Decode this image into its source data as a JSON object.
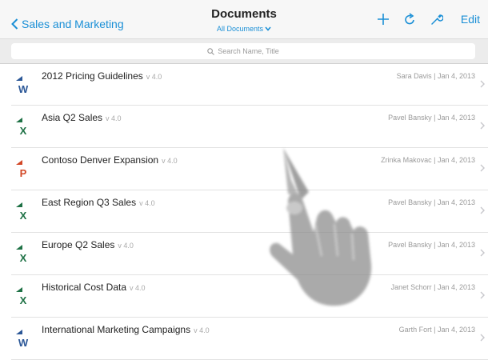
{
  "header": {
    "back_label": "Sales and Marketing",
    "title": "Documents",
    "subtitle": "All Documents",
    "edit_label": "Edit"
  },
  "search": {
    "placeholder": "Search Name, Title"
  },
  "colors": {
    "accent": "#1a8fd6",
    "word": "#2b5797",
    "excel": "#1e7145",
    "powerpoint": "#d24726"
  },
  "documents": [
    {
      "name": "2012 Pricing Guidelines",
      "version": "v 4.0",
      "meta": "Sara Davis | Jan 4, 2013",
      "type": "word",
      "letter": "W"
    },
    {
      "name": "Asia Q2 Sales",
      "version": "v 4.0",
      "meta": "Pavel Bansky | Jan 4, 2013",
      "type": "excel",
      "letter": "X"
    },
    {
      "name": "Contoso Denver Expansion",
      "version": "v 4.0",
      "meta": "Zrinka Makovac | Jan 4, 2013",
      "type": "powerpoint",
      "letter": "P"
    },
    {
      "name": "East Region Q3 Sales",
      "version": "v 4.0",
      "meta": "Pavel Bansky | Jan 4, 2013",
      "type": "excel",
      "letter": "X"
    },
    {
      "name": "Europe Q2 Sales",
      "version": "v 4.0",
      "meta": "Pavel Bansky | Jan 4, 2013",
      "type": "excel",
      "letter": "X"
    },
    {
      "name": "Historical Cost Data",
      "version": "v 4.0",
      "meta": "Janet Schorr | Jan 4, 2013",
      "type": "excel",
      "letter": "X"
    },
    {
      "name": "International Marketing Campaigns",
      "version": "v 4.0",
      "meta": "Garth Fort | Jan 4, 2013",
      "type": "word",
      "letter": "W"
    }
  ]
}
